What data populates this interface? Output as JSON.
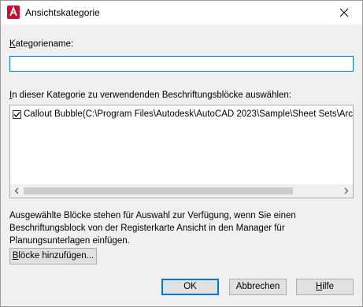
{
  "window": {
    "title": "Ansichtskategorie",
    "app_icon": "autocad-app-icon",
    "close_icon": "close-icon"
  },
  "form": {
    "name_label": "Kategoriename:",
    "name_value": "",
    "blocks_label": "In dieser Kategorie zu verwendenden Beschriftungsblöcke auswählen:",
    "blocks": [
      {
        "checked": true,
        "text": "Callout Bubble(C:\\Program Files\\Autodesk\\AutoCAD 2023\\Sample\\Sheet Sets\\Architectu"
      }
    ],
    "info_text": "Ausgewählte Blöcke stehen für Auswahl zur Verfügung, wenn Sie einen Beschriftungsblock von der Registerkarte Ansicht in den Manager für Planungsunterlagen einfügen.",
    "add_blocks_label": "Blöcke hinzufügen..."
  },
  "buttons": {
    "ok": "OK",
    "cancel": "Abbrechen",
    "help": "Hilfe"
  }
}
